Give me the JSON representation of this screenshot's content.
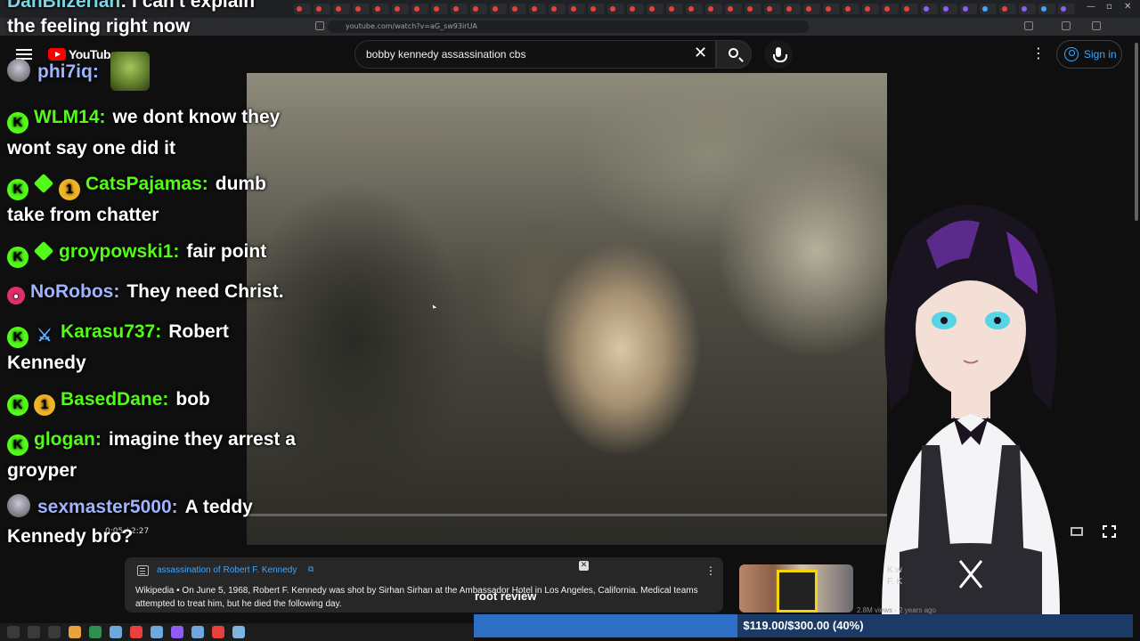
{
  "browser": {
    "url": "youtube.com/watch?v=aG_sw93irUA",
    "tab_colors": [
      "#e8403a",
      "#e8403a",
      "#e8403a",
      "#e8403a",
      "#e8403a",
      "#e8403a",
      "#e8403a",
      "#e8403a",
      "#e8403a",
      "#e8403a",
      "#e8403a",
      "#e8403a",
      "#e8403a",
      "#e8403a",
      "#e8403a",
      "#e8403a",
      "#e8403a",
      "#e8403a",
      "#e8403a",
      "#e8403a",
      "#e8403a",
      "#e8403a",
      "#e8403a",
      "#e8403a",
      "#e8403a",
      "#e8403a",
      "#e8403a",
      "#e8403a",
      "#e8403a",
      "#e8403a",
      "#e8403a",
      "#e8403a",
      "#8f5cf6",
      "#8f5cf6",
      "#8f5cf6",
      "#3ea6ff",
      "#e8403a",
      "#8f5cf6",
      "#3ea6ff",
      "#8f5cf6"
    ]
  },
  "youtube": {
    "logo_text": "YouTube",
    "search_query": "bobby kennedy assassination cbs",
    "sign_in_label": "Sign in"
  },
  "player": {
    "time": "0:05 / 2:27"
  },
  "chat": {
    "top_partial_user": "DanBilzerian",
    "top_partial_text": "I can't explain",
    "top_partial_text2": "the feeling right now",
    "emote_user": "phi7iq:",
    "messages": [
      {
        "user": "WLM14:",
        "text": "we dont know they wont say one did it",
        "color": "#53fc18",
        "badges": [
          "k"
        ]
      },
      {
        "user": "CatsPajamas:",
        "text": "dumb take from chatter",
        "color": "#53fc18",
        "badges": [
          "k",
          "g",
          "1"
        ]
      },
      {
        "user": "groypowski1:",
        "text": "fair point",
        "color": "#53fc18",
        "badges": [
          "k",
          "g"
        ]
      },
      {
        "user": "NoRobos:",
        "text": "They need Christ.",
        "color": "#9fb3ff",
        "badges": [
          "pink"
        ]
      },
      {
        "user": "Karasu737:",
        "text": "Robert Kennedy",
        "color": "#53fc18",
        "badges": [
          "k",
          "sword"
        ]
      },
      {
        "user": "BasedDane:",
        "text": "bob",
        "color": "#53fc18",
        "badges": [
          "k",
          "1"
        ]
      },
      {
        "user": "glogan:",
        "text": "imagine they arrest a groyper",
        "color": "#53fc18",
        "badges": [
          "k"
        ]
      },
      {
        "user": "sexmaster5000:",
        "text": "A teddy Kennedy bro?",
        "color": "#9fb3ff",
        "badges": [
          "avatar"
        ]
      }
    ]
  },
  "info_panel": {
    "title": "assassination of Robert F. Kennedy",
    "source": "Wikipedia",
    "text": " • On June 5, 1968, Robert F. Kennedy was shot by Sirhan Sirhan at the Ambassador Hotel in Los Angeles, California. Medical teams attempted to treat him, but he died the following day."
  },
  "related": {
    "title_line1": "K w",
    "title_line2": "F. K",
    "meta": "2.8M views · 2 years ago"
  },
  "goal": {
    "label": "root review",
    "text": "$119.00/$300.00 (40%)",
    "fraction": 0.4
  },
  "taskbar": {
    "icon_colors": [
      "#3a3a3a",
      "#3a3a3a",
      "#3a3a3a",
      "#e8a33a",
      "#2f8f4e",
      "#6fa8dc",
      "#e8403a",
      "#6fa8dc",
      "#8f5cf6",
      "#6fa8dc",
      "#e8403a",
      "#7fb3e0"
    ]
  }
}
